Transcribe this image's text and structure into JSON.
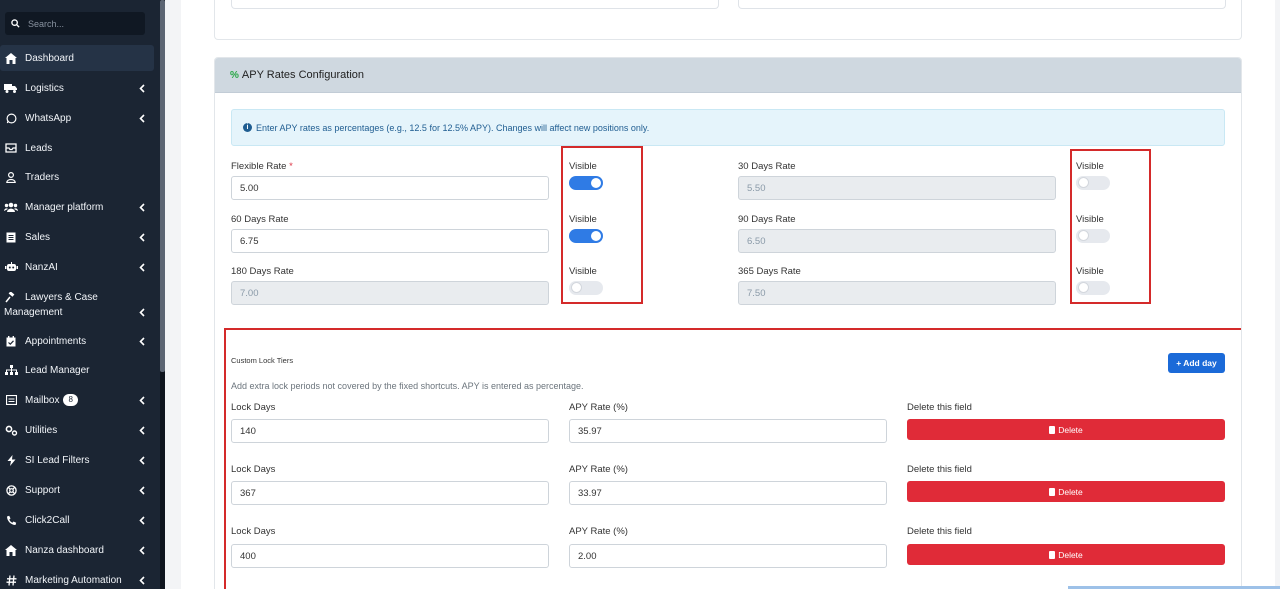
{
  "sidebar": {
    "search_placeholder": "Search...",
    "items": [
      {
        "label": "Dashboard"
      },
      {
        "label": "Logistics"
      },
      {
        "label": "WhatsApp"
      },
      {
        "label": "Leads"
      },
      {
        "label": "Traders"
      },
      {
        "label": "Manager platform"
      },
      {
        "label": "Sales"
      },
      {
        "label": "NanzAI"
      },
      {
        "label": "Lawyers & Case"
      },
      {
        "label": "Management"
      },
      {
        "label": "Appointments"
      },
      {
        "label": "Lead Manager"
      },
      {
        "label": "Mailbox",
        "badge": "8"
      },
      {
        "label": "Utilities"
      },
      {
        "label": "SI Lead Filters"
      },
      {
        "label": "Support"
      },
      {
        "label": "Click2Call"
      },
      {
        "label": "Nanza dashboard"
      },
      {
        "label": "Marketing Automation"
      }
    ]
  },
  "apy": {
    "title": "APY Rates Configuration",
    "info": "Enter APY rates as percentages (e.g., 12.5 for 12.5% APY). Changes will affect new positions only.",
    "visible_label": "Visible",
    "required_mark": "*",
    "rates": [
      {
        "label": "Flexible Rate",
        "value": "5.00",
        "visible": true
      },
      {
        "label": "60 Days Rate",
        "value": "6.75",
        "visible": true
      },
      {
        "label": "180 Days Rate",
        "value": "7.00",
        "visible": false
      },
      {
        "label": "30 Days Rate",
        "value": "5.50",
        "visible": false
      },
      {
        "label": "90 Days Rate",
        "value": "6.50",
        "visible": false
      },
      {
        "label": "365 Days Rate",
        "value": "7.50",
        "visible": false
      }
    ]
  },
  "custom": {
    "title": "Custom Lock Tiers",
    "hint": "Add extra lock periods not covered by the fixed shortcuts. APY is entered as percentage.",
    "add_label": "+ Add day",
    "lock_days_label": "Lock Days",
    "apy_rate_label": "APY Rate (%)",
    "delete_field_label": "Delete this field",
    "delete_label": "Delete",
    "tiers": [
      {
        "days": "140",
        "rate": "35.97"
      },
      {
        "days": "367",
        "rate": "33.97"
      },
      {
        "days": "400",
        "rate": "2.00"
      }
    ]
  },
  "colors": {
    "accent": "#2f7be5",
    "danger": "#e02b38",
    "highlight": "#d42a2a",
    "sidebar": "#1b2533"
  }
}
